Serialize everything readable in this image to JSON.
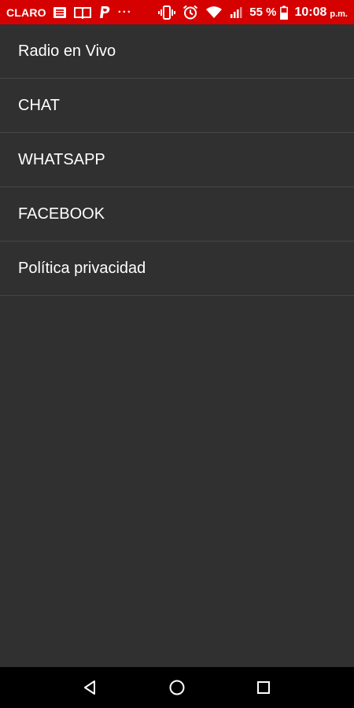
{
  "status_bar": {
    "carrier": "CLARO",
    "dots": "···",
    "battery_percent": "55 %",
    "time": "10:08",
    "time_suffix": "p.m.",
    "bg_color": "#d50000",
    "icons": [
      "news-icon",
      "book-icon",
      "paypal-icon",
      "vibrate-icon",
      "alarm-icon",
      "wifi-icon",
      "signal-icon",
      "battery-icon"
    ]
  },
  "menu": {
    "items": [
      {
        "label": "Radio en Vivo"
      },
      {
        "label": "CHAT"
      },
      {
        "label": "WHATSAPP"
      },
      {
        "label": "FACEBOOK"
      },
      {
        "label": "Política privacidad"
      }
    ]
  },
  "nav_bar": {
    "icons": [
      "back-icon",
      "home-icon",
      "recents-icon"
    ]
  }
}
